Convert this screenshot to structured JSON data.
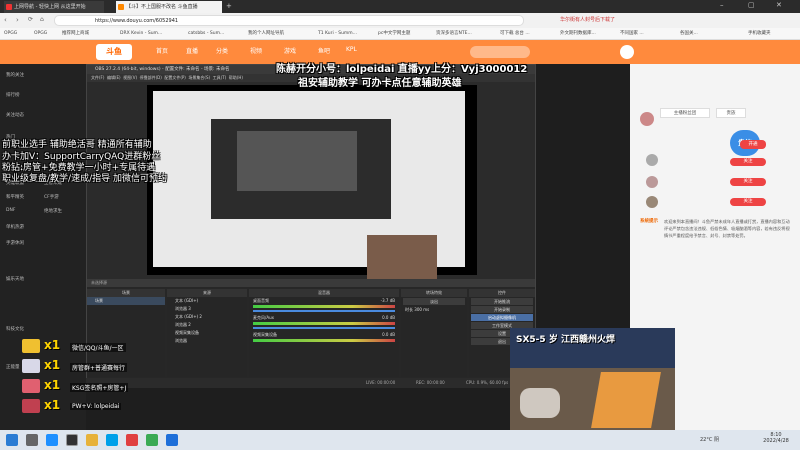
{
  "browser": {
    "tabs": [
      {
        "label": "上网导航 - 轻快上网 从这里开始",
        "active": false
      },
      {
        "label": "【斗】不上国服不改名 斗鱼直播",
        "active": true
      },
      {
        "label": "",
        "active": false
      }
    ],
    "url": "https://www.douyu.com/6052941",
    "bookmarks": [
      "OPGG",
      "OPGG",
      "推荐网上商城",
      "DRX Kevin - Sum...",
      "catsbbs - Sum...",
      "我的个人网址导航",
      "T1 Kuri - Summ...",
      "pc中文学网主题",
      "资深多语言NTE...",
      "可下载 总台 ...",
      "外文期刊数据库...",
      "不同国家 ...",
      "各国关..."
    ],
    "bookmark_right": "手机收藏夹"
  },
  "site": {
    "nav": [
      "首页",
      "直播",
      "分类",
      "视频",
      "游戏",
      "鱼吧",
      "KPL"
    ],
    "left_sidebar": [
      "我的关注",
      "排行榜",
      "关注动态",
      "热门",
      "网游竞技",
      "英雄联盟",
      "王者荣耀",
      "和平精英",
      "CF手游",
      "DNF",
      "绝地求生",
      "单机热游",
      "手游休闲",
      "娱乐天地",
      "科技文化",
      "正能量"
    ],
    "right_panel": {
      "buttons": [
        "主播粉丝团",
        "贵族",
        "开通"
      ],
      "chat": [
        {
          "user": "",
          "text": "查看更多"
        },
        {
          "user": "",
          "text": "关注"
        },
        {
          "user": "",
          "text": "关注"
        },
        {
          "user": "",
          "text": "关注"
        }
      ],
      "notice_label": "系统提示",
      "notice_text": "欢迎来到本直播间！斗鱼严禁未成年人直播或打赏，直播内容和互动评论严禁包含违法违规、低俗色情、吸烟酗酒等内容，若有违反将视情节严重程度给予禁言、封号、封禁等处罚。"
    }
  },
  "obs": {
    "title": "OBS 27.2.4 (64-bit, windows) - 配置文件: 未命名 - 场景: 未命名",
    "menu": [
      "文件(F)",
      "编辑(E)",
      "视图(V)",
      "停靠部件(D)",
      "配置文件(P)",
      "场景集合(S)",
      "工具(T)",
      "帮助(H)"
    ],
    "docks": {
      "scenes_header": "场景",
      "scenes": [
        "场景"
      ],
      "sources_header": "来源",
      "sources": [
        "文本 (GDI+)",
        "浏览器 3",
        "文本 (GDI+) 2",
        "浏览器 2",
        "视频采集设备",
        "浏览器"
      ],
      "mixer_header": "混音器",
      "mixer": [
        {
          "name": "桌面音频",
          "level": "-3.7 dB"
        },
        {
          "name": "麦克风/Aux",
          "level": "0.0 dB"
        },
        {
          "name": "视频采集设备",
          "level": "0.0 dB"
        }
      ],
      "transitions_header": "转场特效",
      "transition": "淡出",
      "duration_label": "时长",
      "duration": "300 ms",
      "controls_header": "控件",
      "controls": [
        "开始推流",
        "开始录制",
        "启动虚拟摄像机",
        "工作室模式",
        "设置",
        "退出"
      ]
    },
    "status": {
      "live": "LIVE: 00:00:00",
      "rec": "REC: 00:00:00",
      "cpu": "CPU: 0.9%, 60.00 fps"
    },
    "scene_label": "未选择源"
  },
  "overlay": {
    "top_line1": "陈赫开分小号：lolpeidai  直播yy上分：Vyj3000012",
    "top_line2": "祖安辅助教学 可办卡点任意辅助英雄",
    "left_lines": [
      "前职业选手 辅助绝活哥 精通所有辅助",
      "办卡加V：SupportCarryQAQ进群粉丝",
      "粉钻:房管+免费教学一小时+专属待遇",
      "职业级复盘/教学/速成/指导 加微信可预约"
    ],
    "gifts": [
      {
        "count": "x1",
        "label": "微信/QQ/斗鱼/一区"
      },
      {
        "count": "x1",
        "label": "房管群+普通赛每行"
      },
      {
        "count": "x1",
        "label": "KSG签名照+房管+J"
      },
      {
        "count": "x1",
        "label": "PW+V: lolpeidai"
      }
    ],
    "cam_text": "SX5-5 岁 江西赣州火焊"
  },
  "taskbar": {
    "weather": "22°C 阴",
    "time": "8:10",
    "date": "2022/4/28"
  }
}
